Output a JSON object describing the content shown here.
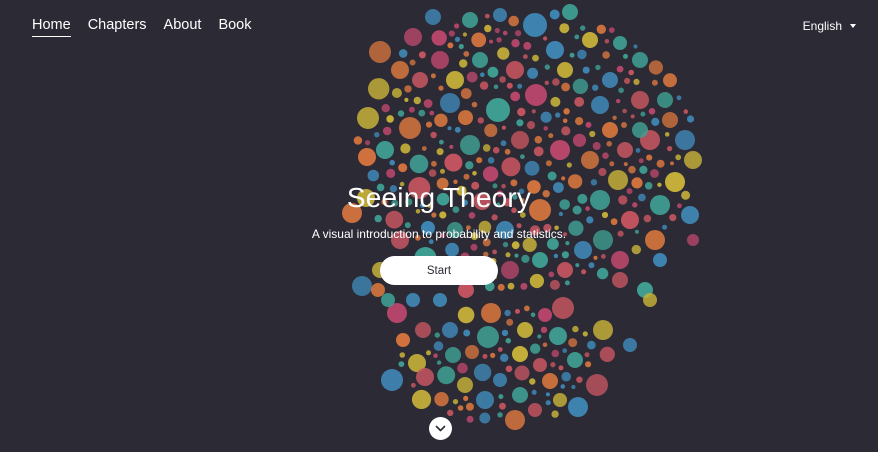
{
  "nav": {
    "items": [
      {
        "label": "Home",
        "active": true
      },
      {
        "label": "Chapters",
        "active": false
      },
      {
        "label": "About",
        "active": false
      },
      {
        "label": "Book",
        "active": false
      }
    ]
  },
  "language": {
    "selected": "English",
    "icon": "caret-down-icon"
  },
  "hero": {
    "title": "Seeing Theory",
    "subtitle": "A visual introduction to probability and statistics.",
    "start_label": "Start"
  },
  "scroll": {
    "icon": "chevron-down-icon"
  },
  "colors": {
    "background": "#2b2a35",
    "dot_palette": [
      "#c35560",
      "#d1733e",
      "#3f86b4",
      "#c7b13a",
      "#3f9e92",
      "#b8476b"
    ]
  }
}
